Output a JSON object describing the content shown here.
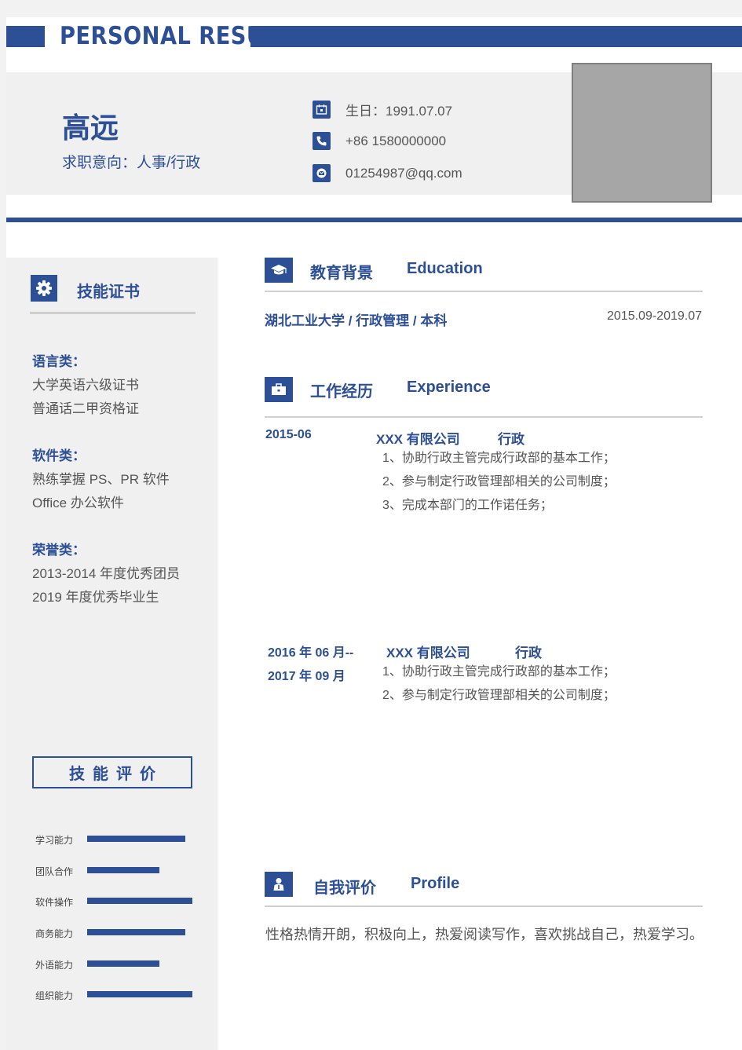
{
  "banner": {
    "title": "PERSONAL  RESUME"
  },
  "header": {
    "name": "高远",
    "intent": "求职意向：人事/行政",
    "contacts": {
      "birthday": "生日：1991.07.07",
      "phone": "+86  1580000000",
      "email": "01254987@qq.com"
    }
  },
  "sidebar": {
    "cert_title": "技能证书",
    "groups": [
      {
        "head": "语言类：",
        "items": [
          "大学英语六级证书",
          "普通话二甲资格证"
        ]
      },
      {
        "head": "软件类：",
        "items": [
          "熟练掌握 PS、PR 软件",
          "Office 办公软件"
        ]
      },
      {
        "head": "荣誉类：",
        "items": [
          "2013-2014 年度优秀团员",
          "2019 年度优秀毕业生"
        ]
      }
    ],
    "skill_title": "技能评价",
    "skills": [
      {
        "label": "学习能力",
        "level": 0.93
      },
      {
        "label": "团队合作",
        "level": 0.69
      },
      {
        "label": "软件操作",
        "level": 1.0
      },
      {
        "label": "商务能力",
        "level": 0.93
      },
      {
        "label": "外语能力",
        "level": 0.69
      },
      {
        "label": "组织能力",
        "level": 1.0
      }
    ]
  },
  "education": {
    "title_cn": "教育背景",
    "title_en": "Education",
    "line": "湖北工业大学 / 行政管理 / 本科",
    "date": "2015.09-2019.07"
  },
  "experience": {
    "title_cn": "工作经历",
    "title_en": "Experience",
    "jobs": [
      {
        "date_1": "2015-06",
        "date_2": "",
        "company": "XXX 有限公司",
        "role": "行政",
        "duties": [
          "1、协助行政主管完成行政部的基本工作；",
          "2、参与制定行政管理部相关的公司制度；",
          "3、完成本部门的工作诺任务；"
        ]
      },
      {
        "date_1": "2016 年 06 月--",
        "date_2": "2017 年 09 月",
        "company": "XXX 有限公司",
        "role": "行政",
        "duties": [
          "1、协助行政主管完成行政部的基本工作；",
          "2、参与制定行政管理部相关的公司制度；"
        ]
      }
    ]
  },
  "profile": {
    "title_cn": "自我评价",
    "title_en": "Profile",
    "text": "性格热情开朗，积极向上，热爱阅读写作，喜欢挑战自己，热爱学习。"
  },
  "colors": {
    "accent": "#2c4f96",
    "panel": "#f0f0f0",
    "photo": "#a6a6a6"
  }
}
